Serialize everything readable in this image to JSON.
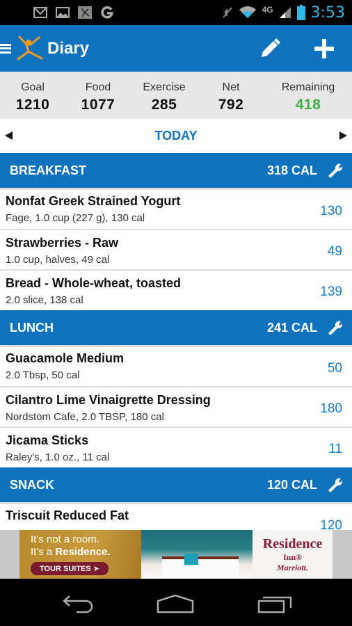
{
  "status_bar": {
    "notification_icons": [
      "gmail-icon",
      "gallery-icon",
      "myfitnesspal-icon",
      "google-icon"
    ],
    "system_icons": [
      "mute-icon",
      "wifi-icon",
      "4g-lte-icon",
      "signal-icon",
      "battery-icon"
    ],
    "network_label": "4G",
    "time": "3:53"
  },
  "action_bar": {
    "title": "Diary",
    "edit_icon": "pencil-icon",
    "add_icon": "plus-icon"
  },
  "summary": {
    "columns": [
      {
        "label": "Goal",
        "value": "1210"
      },
      {
        "label": "Food",
        "value": "1077"
      },
      {
        "label": "Exercise",
        "value": "285"
      },
      {
        "label": "Net",
        "value": "792"
      },
      {
        "label": "Remaining",
        "value": "418"
      }
    ],
    "remaining_color": "#3fae49"
  },
  "date_nav": {
    "label": "TODAY"
  },
  "meals": [
    {
      "name": "BREAKFAST",
      "calories": "318 CAL",
      "items": [
        {
          "name": "Nonfat Greek Strained Yogurt",
          "desc": "Fage, 1.0 cup (227 g), 130 cal",
          "cal": "130"
        },
        {
          "name": "Strawberries - Raw",
          "desc": "1.0 cup, halves, 49 cal",
          "cal": "49"
        },
        {
          "name": "Bread - Whole-wheat, toasted",
          "desc": "2.0 slice, 138 cal",
          "cal": "139"
        }
      ]
    },
    {
      "name": "LUNCH",
      "calories": "241 CAL",
      "items": [
        {
          "name": "Guacamole Medium",
          "desc": "2.0 Tbsp, 50 cal",
          "cal": "50"
        },
        {
          "name": "Cilantro Lime Vinaigrette Dressing",
          "desc": "Nordstom Cafe, 2.0 TBSP, 180 cal",
          "cal": "180"
        },
        {
          "name": "Jicama Sticks",
          "desc": "Raley's, 1.0 oz., 11 cal",
          "cal": "11"
        }
      ]
    },
    {
      "name": "SNACK",
      "calories": "120 CAL",
      "items": [
        {
          "name": "Triscuit Reduced Fat",
          "desc": "",
          "cal": "120"
        }
      ]
    }
  ],
  "ad": {
    "line1": "It's not a room.",
    "line2_prefix": "It's a ",
    "line2_bold": "Residence.",
    "cta": "TOUR SUITES ➤",
    "brand": "Residence",
    "brand_sub": "Inn®",
    "brand_parent": "Marriott."
  },
  "nav_bar": {
    "buttons": [
      "back-icon",
      "home-icon",
      "recent-apps-icon"
    ]
  },
  "colors": {
    "primary": "#0f72bf",
    "calorie_text": "#1a7cc7",
    "remaining": "#3fae49",
    "time": "#33b5e5"
  }
}
